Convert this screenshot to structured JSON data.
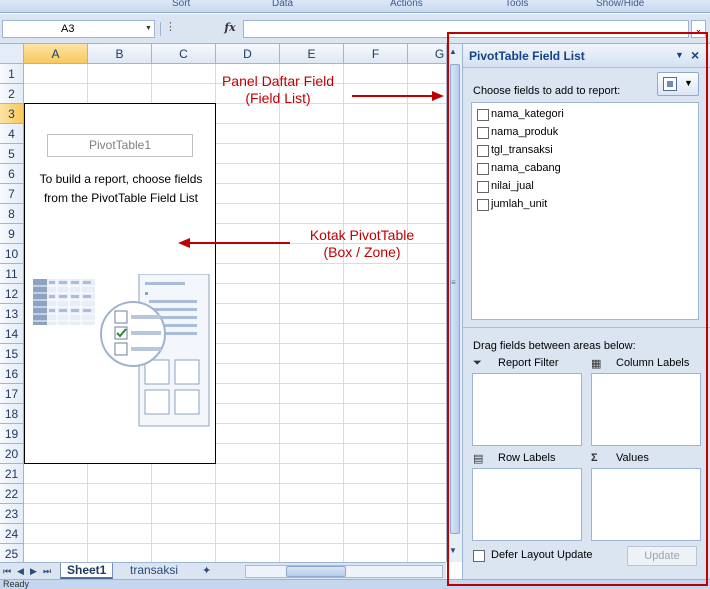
{
  "ribbon": {
    "groups": [
      "Sort",
      "Data",
      "Actions",
      "Tools",
      "Show/Hide"
    ]
  },
  "formula_bar": {
    "name_box": "A3",
    "fx_label": "fx",
    "formula": ""
  },
  "sheet": {
    "columns": [
      "A",
      "B",
      "C",
      "D",
      "E",
      "F",
      "G"
    ],
    "rows": [
      "1",
      "2",
      "3",
      "4",
      "5",
      "6",
      "7",
      "8",
      "9",
      "10",
      "11",
      "12",
      "13",
      "14",
      "15",
      "16",
      "17",
      "18",
      "19",
      "20",
      "21",
      "22",
      "23",
      "24",
      "25"
    ],
    "selected_column": "A",
    "selected_row": "3"
  },
  "pivot_placeholder": {
    "name": "PivotTable1",
    "instruction": "To build a report, choose fields from the PivotTable Field List"
  },
  "sheet_tabs": [
    "Sheet1",
    "transaksi"
  ],
  "active_tab": "Sheet1",
  "status": {
    "text": "Ready"
  },
  "field_list": {
    "title": "PivotTable Field List",
    "choose_label": "Choose fields to add to report:",
    "fields": [
      "nama_kategori",
      "nama_produk",
      "tgl_transaksi",
      "nama_cabang",
      "nilai_jual",
      "jumlah_unit"
    ],
    "drag_label": "Drag fields between areas below:",
    "areas": {
      "report_filter": "Report Filter",
      "column_labels": "Column Labels",
      "row_labels": "Row Labels",
      "values": "Values"
    },
    "defer_label": "Defer Layout Update",
    "update_label": "Update"
  },
  "annotations": {
    "panel_line1": "Panel Daftar Field",
    "panel_line2": "(Field List)",
    "box_line1": "Kotak PivotTable",
    "box_line2": "(Box / Zone)"
  },
  "colors": {
    "annotation": "#c00000",
    "pane_bg": "#dbe5f1",
    "title_text": "#15428b",
    "selection": "#f8c85a"
  }
}
